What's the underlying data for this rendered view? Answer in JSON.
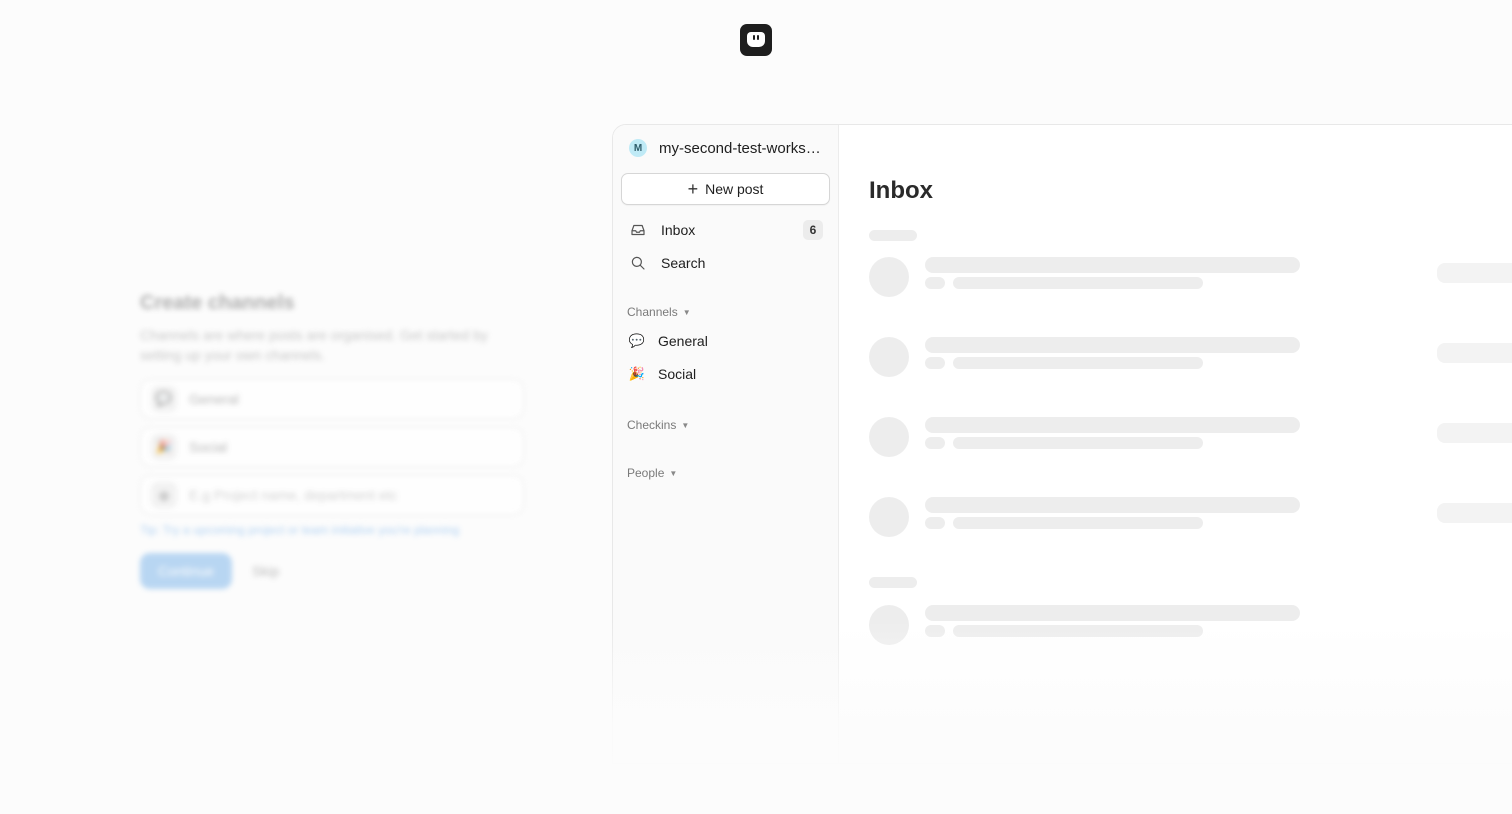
{
  "onboarding": {
    "title": "Create channels",
    "description": "Channels are where posts are organised. Get started by setting up your own channels.",
    "fields": [
      {
        "emoji": "💬",
        "value": "General"
      },
      {
        "emoji": "🎉",
        "value": "Social"
      }
    ],
    "new_field_emoji": "☺",
    "new_field_placeholder": "E.g Project name, department etc",
    "tip": "Tip: Try a upcoming project or team initiative you're planning",
    "continue_label": "Continue",
    "skip_label": "Skip"
  },
  "sidebar": {
    "workspace_initial": "M",
    "workspace_name": "my-second-test-workspace",
    "new_post_label": "New post",
    "nav": [
      {
        "label": "Inbox",
        "icon": "inbox-icon",
        "badge": "6"
      },
      {
        "label": "Search",
        "icon": "search-icon"
      }
    ],
    "sections": {
      "channels": "Channels",
      "checkins": "Checkins",
      "people": "People"
    },
    "channels": [
      {
        "emoji": "💬",
        "label": "General"
      },
      {
        "emoji": "🎉",
        "label": "Social"
      }
    ]
  },
  "main": {
    "title": "Inbox"
  }
}
